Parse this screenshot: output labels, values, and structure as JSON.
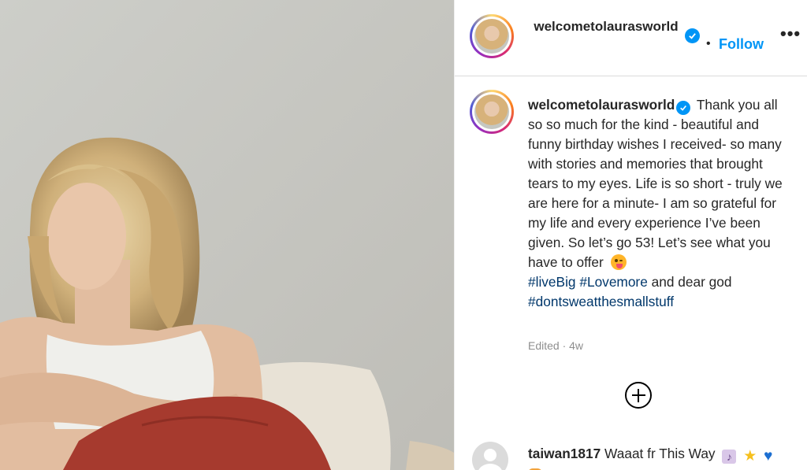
{
  "post": {
    "username": "welcometolaurasworld",
    "follow_label": "Follow",
    "dot": "•",
    "more_label": "•••",
    "caption": {
      "username": "welcometolaurasworld",
      "text": "Thank you all so so much for the kind - beautiful and funny birthday wishes I received- so many with stories and memories that brought tears to my eyes. Life is so short - truly we are here for a minute- I am so grateful for my life and every experience I’ve been given. So let’s go 53! Let’s see what you have to offer",
      "hashtag1": "#liveBig",
      "hashtag2": "#Lovemore",
      "mid_text": "and dear god",
      "hashtag3": "#dontsweatthesmallstuff"
    },
    "meta": "Edited · 4w",
    "comment": {
      "username": "taiwan1817",
      "text": "Waaat fr This Way"
    }
  },
  "icons": {
    "verified": "verified-badge-icon",
    "more": "more-options-icon",
    "add": "add-circle-icon",
    "emoji": "zany-face-emoji",
    "clef": "music-clef-emoji",
    "star": "star-emoji",
    "heart": "blue-heart-emoji"
  },
  "colors": {
    "link": "#0095f6",
    "hashtag": "#00376b",
    "meta": "#8e8e8e",
    "verified": "#0095f6"
  }
}
